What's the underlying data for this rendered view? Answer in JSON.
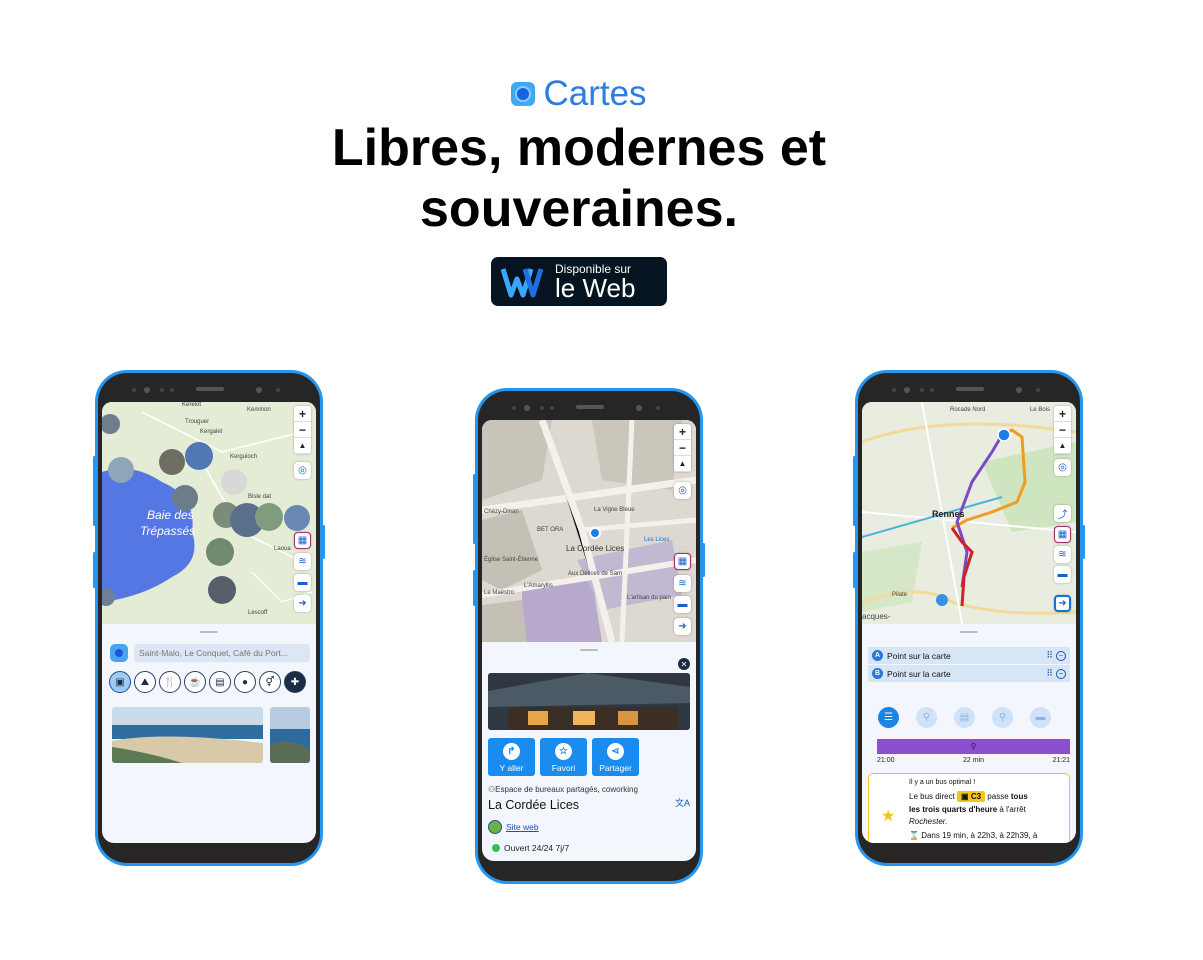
{
  "brand": {
    "name": "Cartes",
    "logo_icon": "cartes-logo-icon"
  },
  "headline": {
    "line1": "Libres, modernes et",
    "line2": "souveraines."
  },
  "web_badge": {
    "small": "Disponible sur",
    "big": "le Web"
  },
  "phone1": {
    "map_labels": [
      "Kerelot",
      "Keminon",
      "Trouguer",
      "Kergalet",
      "Kerguioch",
      "Baie des",
      "Trépassés",
      "Bisle dat",
      "Laoua",
      "Lescoff"
    ],
    "search_placeholder": "Saint-Malo, Le Conquet, Café du Port...",
    "categories": [
      "image-icon",
      "hiking-icon",
      "restaurant-icon",
      "cafe-icon",
      "bus-icon",
      "water-icon",
      "toilets-icon",
      "more-icon"
    ]
  },
  "phone2": {
    "map_labels": [
      "Chézy-Dinan",
      "La Vigne Bleue",
      "BET ORA",
      "La Cordée Lices",
      "Les Lices",
      "Église Saint-Étienne",
      "Aux Délices de Sam",
      "L'Amaryllis",
      "Le Maëstro",
      "L'artisan du pain"
    ],
    "actions": [
      {
        "label": "Y aller",
        "icon": "directions-icon"
      },
      {
        "label": "Favori",
        "icon": "star-icon"
      },
      {
        "label": "Partager",
        "icon": "share-icon"
      }
    ],
    "poi_type": "Espace de bureaux partagés, coworking",
    "poi_name": "La Cordée Lices",
    "website": "Site web",
    "opening": "Ouvert 24/24 7j/7"
  },
  "phone3": {
    "map_labels": [
      "Rocade Nord",
      "Le Bois",
      "Rennes",
      "Pilate",
      "acques-"
    ],
    "points": [
      {
        "letter": "A",
        "label": "Point sur la carte"
      },
      {
        "letter": "B",
        "label": "Point sur la carte"
      }
    ],
    "modes": [
      "transit-icon",
      "bike-icon",
      "bus-icon",
      "walk-icon",
      "car-icon"
    ],
    "timeline": {
      "start": "21:00",
      "duration": "22 min",
      "end": "21:21"
    },
    "bus_card": {
      "line1": "Il y a un bus optimal !",
      "line2a": "Le bus direct",
      "bus": "C3",
      "line2b": "passe",
      "line2c": "tous",
      "line3a": "les trois quarts d'heure",
      "line3b": "à l'arrêt",
      "line4": "Rochester.",
      "line5": "Dans 19 min, à 22h3, à 22h39, à"
    }
  }
}
